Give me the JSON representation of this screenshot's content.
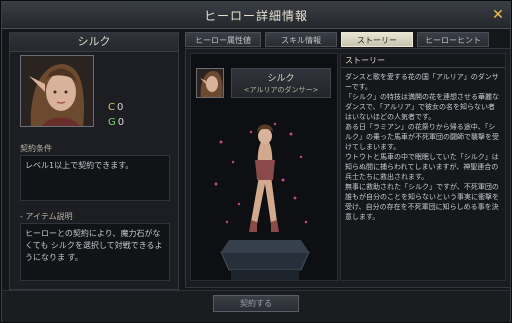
{
  "window": {
    "title": "ヒーロー詳細情報"
  },
  "left": {
    "hero_name": "シルク",
    "currency": [
      {
        "icon": "coin-c-icon",
        "symbol": "C",
        "value": "0"
      },
      {
        "icon": "coin-g-icon",
        "symbol": "G",
        "value": "0"
      }
    ],
    "contract_label": "契約条件",
    "contract_text": "レベル1以上で契約できます。",
    "item_label": "- アイテム説明",
    "item_text": "ヒーローとの契約により、魔力石がなくても シルクを選択して対戦できるようになりま す。"
  },
  "tabs": [
    {
      "label": "ヒーロー属性値"
    },
    {
      "label": "スキル情報"
    },
    {
      "label": "ストーリー"
    },
    {
      "label": "ヒーローヒント"
    }
  ],
  "model": {
    "name": "シルク",
    "title": "<アルリアのダンサー>"
  },
  "story": {
    "header": "ストーリー",
    "text": "ダンスと歌を愛する花の国「アルリア」のダンサーです。\n「シルク」の特技は満開の花を連想させる華麗なダンスで、「アルリア」で彼女の名を知らない者はいないほどの人気者です。\nある日「ラミアン」の花祭りから帰る途中、「シルク」の乗った馬車が不死軍団の闘師で襲撃を受けてしまいます。\nウトウトと馬車の中で眠眠していた「シルク」は知らぬ間に捕らわれてしまいますが、神聖連合の兵士たちに救出されます。\n無事に救助された「シルク」ですが、不死軍団の誰もが自分のことを知らないという事実に衝撃を受け、自分の存在を不死軍団に知らしめる事を決意します。"
  },
  "footer": {
    "contract_button": "契約する"
  }
}
